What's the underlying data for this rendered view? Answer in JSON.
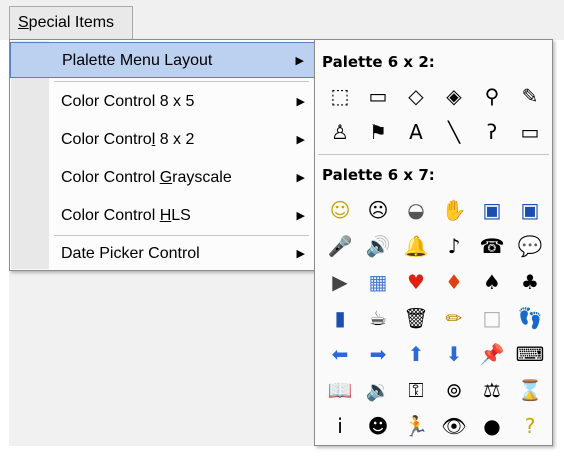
{
  "menubar": {
    "title": "Special Items",
    "title_mnemonic": "S",
    "title_rest": "pecial Items"
  },
  "menu": {
    "items": [
      {
        "label": "Plalette Menu Layout",
        "arrow": "▶",
        "highlight": true
      },
      {
        "label_pre": "Color Control 8 x 5",
        "arrow": "▶"
      },
      {
        "label_pre": "Color Contro",
        "label_ul": "l",
        "label_post": " 8 x 2",
        "arrow": "▶"
      },
      {
        "label_pre": "Color Control ",
        "label_ul": "G",
        "label_post": "rayscale",
        "arrow": "▶"
      },
      {
        "label_pre": "Color Control ",
        "label_ul": "H",
        "label_post": "LS",
        "arrow": "▶"
      },
      {
        "label_pre": "Date Picker Control",
        "arrow": "▶"
      }
    ]
  },
  "palette": {
    "heading_1": "Palette 6 x 2:",
    "heading_2": "Palette 6 x 7:",
    "icons_6x2": [
      {
        "name": "lasso-select-icon",
        "glyph": "⬚",
        "color": "#000"
      },
      {
        "name": "rect-select-icon",
        "glyph": "▭",
        "color": "#000"
      },
      {
        "name": "eraser-icon",
        "glyph": "◇",
        "color": "#000"
      },
      {
        "name": "fill-bucket-icon",
        "glyph": "◈",
        "color": "#000"
      },
      {
        "name": "magnifier-icon",
        "glyph": "⚲",
        "color": "#000"
      },
      {
        "name": "pencil-icon",
        "glyph": "✎",
        "color": "#000"
      },
      {
        "name": "brush-icon",
        "glyph": "♙",
        "color": "#000"
      },
      {
        "name": "spray-can-icon",
        "glyph": "⚑",
        "color": "#000"
      },
      {
        "name": "text-tool-icon",
        "glyph": "A",
        "color": "#000"
      },
      {
        "name": "line-tool-icon",
        "glyph": "╲",
        "color": "#000"
      },
      {
        "name": "curve-tool-icon",
        "glyph": "ʔ",
        "color": "#000"
      },
      {
        "name": "rectangle-tool-icon",
        "glyph": "▭",
        "color": "#000"
      }
    ],
    "icons_6x7": [
      {
        "name": "smiley-face-icon",
        "glyph": "☺",
        "color": "#c9a400"
      },
      {
        "name": "sad-face-icon",
        "glyph": "☹",
        "color": "#000"
      },
      {
        "name": "piggy-bank-icon",
        "glyph": "◒",
        "color": "#555"
      },
      {
        "name": "thumbs-up-icon",
        "glyph": "✋",
        "color": "#000"
      },
      {
        "name": "save-disk-icon",
        "glyph": "▣",
        "color": "#1a4fb0"
      },
      {
        "name": "save-disk-alt-icon",
        "glyph": "▣",
        "color": "#1a4fb0"
      },
      {
        "name": "microphone-icon",
        "glyph": "🎤",
        "color": "#666"
      },
      {
        "name": "speaker-icon",
        "glyph": "🔊",
        "color": "#777"
      },
      {
        "name": "bell-icon",
        "glyph": "🔔",
        "color": "#d6a600"
      },
      {
        "name": "music-note-icon",
        "glyph": "♪",
        "color": "#000"
      },
      {
        "name": "telephone-icon",
        "glyph": "☎",
        "color": "#000"
      },
      {
        "name": "speech-bubble-icon",
        "glyph": "💬",
        "color": "#000"
      },
      {
        "name": "projector-icon",
        "glyph": "▶",
        "color": "#444"
      },
      {
        "name": "calculator-icon",
        "glyph": "▦",
        "color": "#4a7bd0"
      },
      {
        "name": "heart-icon",
        "glyph": "♥",
        "color": "#e02010"
      },
      {
        "name": "diamond-icon",
        "glyph": "♦",
        "color": "#e04010"
      },
      {
        "name": "spade-icon",
        "glyph": "♠",
        "color": "#000"
      },
      {
        "name": "club-icon",
        "glyph": "♣",
        "color": "#000"
      },
      {
        "name": "trash-bin-blue-icon",
        "glyph": "▮",
        "color": "#1a4fb0"
      },
      {
        "name": "mug-icon",
        "glyph": "☕",
        "color": "#000"
      },
      {
        "name": "trash-can-icon",
        "glyph": "🗑",
        "color": "#000"
      },
      {
        "name": "pencil-yellow-icon",
        "glyph": "✏",
        "color": "#b08800"
      },
      {
        "name": "blank-page-icon",
        "glyph": "□",
        "color": "#b0b0b0"
      },
      {
        "name": "footprints-icon",
        "glyph": "👣",
        "color": "#000"
      },
      {
        "name": "arrow-left-icon",
        "glyph": "⬅",
        "color": "#2a6ad8"
      },
      {
        "name": "arrow-right-icon",
        "glyph": "➡",
        "color": "#2a6ad8"
      },
      {
        "name": "arrow-up-icon",
        "glyph": "⬆",
        "color": "#2a6ad8"
      },
      {
        "name": "arrow-down-icon",
        "glyph": "⬇",
        "color": "#2a6ad8"
      },
      {
        "name": "pushpin-icon",
        "glyph": "📌",
        "color": "#666"
      },
      {
        "name": "keyboard-icon",
        "glyph": "⌨",
        "color": "#000"
      },
      {
        "name": "book-icon",
        "glyph": "📖",
        "color": "#000"
      },
      {
        "name": "hearing-icon",
        "glyph": "🔉",
        "color": "#000"
      },
      {
        "name": "key-icon",
        "glyph": "⚿",
        "color": "#000"
      },
      {
        "name": "film-reel-icon",
        "glyph": "⊚",
        "color": "#000"
      },
      {
        "name": "scales-icon",
        "glyph": "⚖",
        "color": "#000"
      },
      {
        "name": "hourglass-icon",
        "glyph": "⌛",
        "color": "#000"
      },
      {
        "name": "person-icon",
        "glyph": "i",
        "color": "#000"
      },
      {
        "name": "head-profile-icon",
        "glyph": "☻",
        "color": "#000"
      },
      {
        "name": "running-man-icon",
        "glyph": "🏃",
        "color": "#000"
      },
      {
        "name": "eye-icon",
        "glyph": "👁",
        "color": "#000"
      },
      {
        "name": "eight-ball-icon",
        "glyph": "●",
        "color": "#000"
      },
      {
        "name": "question-mark-icon",
        "glyph": "?",
        "color": "#c9a400"
      }
    ]
  }
}
